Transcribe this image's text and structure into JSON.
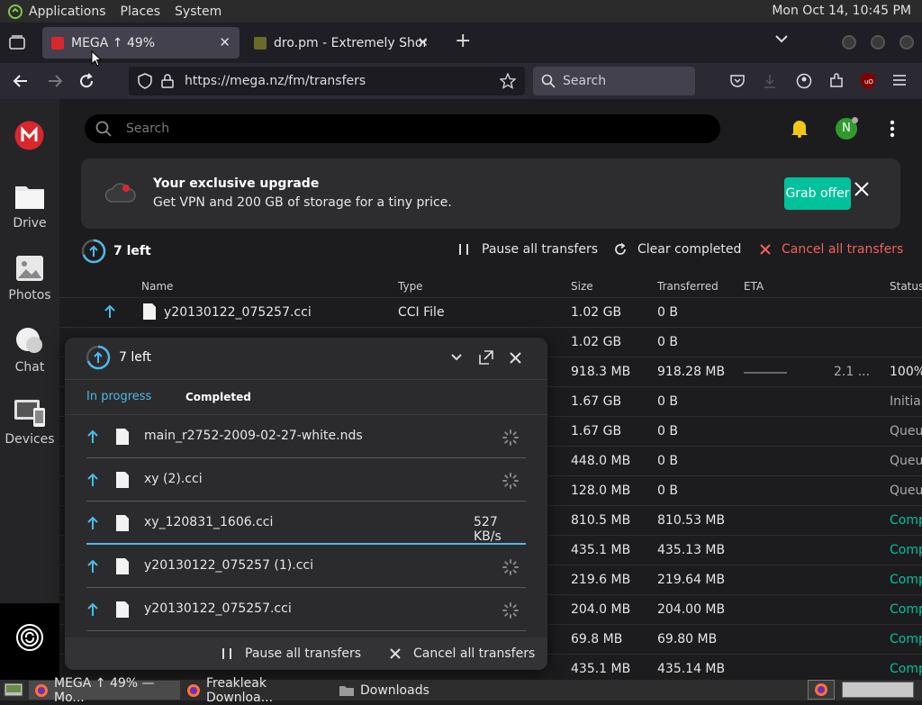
{
  "os": {
    "menu": [
      "Applications",
      "Places",
      "System"
    ],
    "clock": "Mon Oct 14, 10:45 PM"
  },
  "browser": {
    "tabs": [
      {
        "title": "MEGA ↑ 49%",
        "active": true,
        "icon": "mega-favicon"
      },
      {
        "title": "dro.pm - Extremely Short Li",
        "active": false,
        "icon": "dropm-favicon"
      }
    ],
    "url": "https://mega.nz/fm/transfers",
    "search_placeholder": "Search"
  },
  "mega": {
    "sidebar": [
      {
        "label": "Drive",
        "icon": "drive-icon"
      },
      {
        "label": "Photos",
        "icon": "photos-icon"
      },
      {
        "label": "Chat",
        "icon": "chat-icon"
      },
      {
        "label": "Devices",
        "icon": "devices-icon"
      }
    ],
    "search_placeholder": "Search",
    "avatar_letter": "N",
    "promo": {
      "title": "Your exclusive upgrade",
      "text": "Get VPN and 200 GB of storage for a tiny price.",
      "button": "Grab offer"
    },
    "transfers_header": {
      "left_count": "7 left",
      "pause_all": "Pause all transfers",
      "clear_completed": "Clear completed",
      "cancel_all": "Cancel all transfers"
    },
    "columns": [
      "Name",
      "Type",
      "Size",
      "Transferred",
      "ETA",
      "Status"
    ],
    "rows": [
      {
        "name": "y20130122_075257.cci",
        "type": "CCI File",
        "size": "1.02 GB",
        "transferred": "0 B",
        "eta": "",
        "status": ""
      },
      {
        "name": "",
        "type": "",
        "size": "1.02 GB",
        "transferred": "0 B",
        "eta": "",
        "status": ""
      },
      {
        "name": "",
        "type": "",
        "size": "918.3 MB",
        "transferred": "918.28 MB",
        "eta": "2.1 ...",
        "status": "100%"
      },
      {
        "name": "",
        "type": "",
        "size": "1.67 GB",
        "transferred": "0 B",
        "eta": "",
        "status": "Initial"
      },
      {
        "name": "",
        "type": "",
        "size": "1.67 GB",
        "transferred": "0 B",
        "eta": "",
        "status": "Queu"
      },
      {
        "name": "",
        "type": "",
        "size": "448.0 MB",
        "transferred": "0 B",
        "eta": "",
        "status": "Queu"
      },
      {
        "name": "",
        "type": "",
        "size": "128.0 MB",
        "transferred": "0 B",
        "eta": "",
        "status": "Queu"
      },
      {
        "name": "",
        "type": "",
        "size": "810.5 MB",
        "transferred": "810.53 MB",
        "eta": "",
        "status": "Comp"
      },
      {
        "name": "",
        "type": "",
        "size": "435.1 MB",
        "transferred": "435.13 MB",
        "eta": "",
        "status": "Comp"
      },
      {
        "name": "",
        "type": "",
        "size": "219.6 MB",
        "transferred": "219.64 MB",
        "eta": "",
        "status": "Comp"
      },
      {
        "name": "",
        "type": "",
        "size": "204.0 MB",
        "transferred": "204.00 MB",
        "eta": "",
        "status": "Comp"
      },
      {
        "name": "",
        "type": "",
        "size": "69.8 MB",
        "transferred": "69.80 MB",
        "eta": "",
        "status": "Comp"
      },
      {
        "name": "",
        "type": "",
        "size": "435.1 MB",
        "transferred": "435.14 MB",
        "eta": "",
        "status": "Comp"
      }
    ],
    "popup": {
      "left_count": "7 left",
      "tabs": [
        "In progress",
        "Completed"
      ],
      "items": [
        {
          "name": "main_r2752-2009-02-27-white.nds",
          "speed": ""
        },
        {
          "name": "xy (2).cci",
          "speed": ""
        },
        {
          "name": "xy_120831_1606.cci",
          "speed": "527 KB/s"
        },
        {
          "name": "y20130122_075257 (1).cci",
          "speed": ""
        },
        {
          "name": "y20130122_075257.cci",
          "speed": ""
        }
      ],
      "pause_all": "Pause all transfers",
      "cancel_all": "Cancel all transfers"
    }
  },
  "taskbar": {
    "items": [
      "MEGA ↑ 49% — Mo...",
      "Freakleak Downloa...",
      "Downloads"
    ]
  },
  "colors": {
    "mega_red": "#d9272e",
    "accent_teal": "#00c29a",
    "link_blue": "#4fb8e8",
    "cancel_red": "#f0605a",
    "status_green": "#00c29a"
  }
}
